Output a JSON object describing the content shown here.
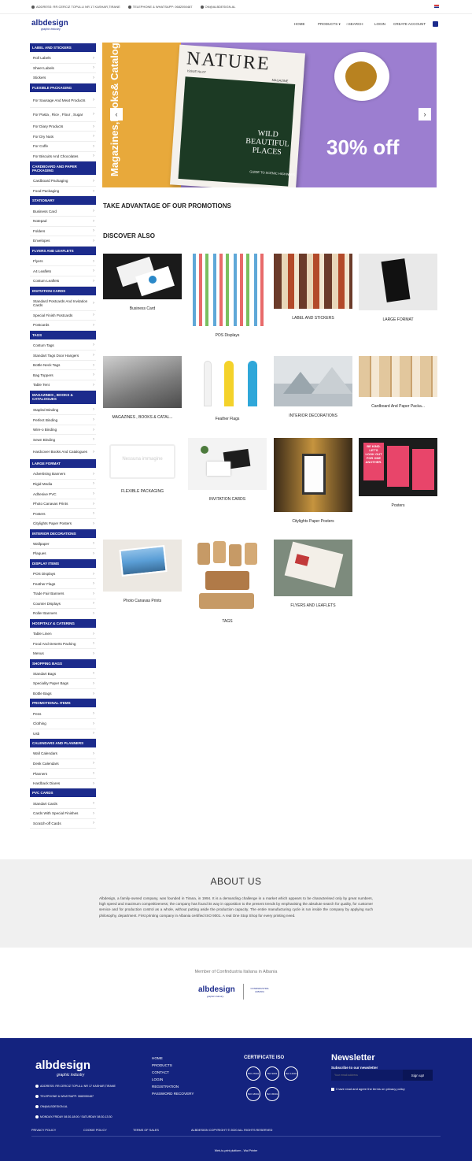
{
  "topbar": {
    "address": "ADDRESS: RR.CERCIZ TOPULLI NR 17 KASHAR,TIRANE",
    "phone": "TELEPHONE & WHATSAPP: 0682050487",
    "email": "ON@ALBDESIGN.AL"
  },
  "header": {
    "logo": "albdesign",
    "logo_sub": "graphic industry",
    "nav": [
      "HOME",
      "PRODUCTS",
      "SEARCH",
      "LOGIN",
      "CREATE ACCOUNT"
    ]
  },
  "sidebar": [
    {
      "title": "LABEL AND STICKERS",
      "items": [
        "Roll Labels",
        "Sheet Labels",
        "Stickers"
      ]
    },
    {
      "title": "FLEXIBLE PACKAGING",
      "items": [
        "For Sausage And Meat Products",
        "For Pasta , Rice , Flour , Sugar",
        "For Diary Products",
        "For Dry Nuts",
        "For Coffe",
        "For Biscuits And Chocolates"
      ]
    },
    {
      "title": "CARDBOARD AND PAPER PACKAGING",
      "items": [
        "Cardboard Packaging",
        "Food Packaging"
      ]
    },
    {
      "title": "STATIONARY",
      "items": [
        "Business Card",
        "Notepad",
        "Folders",
        "Envelopes"
      ]
    },
    {
      "title": "FLYERS AND LEAFLETS",
      "items": [
        "Flyers",
        "A4 Leaflets",
        "Costum Leaflets"
      ]
    },
    {
      "title": "INVITATION CARDS",
      "items": [
        "Standard Postcards And Invitation Cards",
        "Special Finish Postcards",
        "Postcards"
      ]
    },
    {
      "title": "TAGS",
      "items": [
        "Costum Tags",
        "Standart Tags Door Hangers",
        "Bottle Neck Tags",
        "Bag Toppers",
        "Table Tent"
      ]
    },
    {
      "title": "MAGAZINES , BOOKS & CATALOGUES",
      "items": [
        "Stapled Binding",
        "Perfect Binding",
        "Wire-o Binding",
        "Sewn Binding",
        "Hardcover Books And Catalogues"
      ]
    },
    {
      "title": "LARGE FORMAT",
      "items": [
        "Advertising Banners",
        "Rigid Media",
        "Adhesive PVC",
        "Photo Canavas Prints",
        "Posters",
        "Citylights Paper Posters"
      ]
    },
    {
      "title": "INTERIOR DECORATIONS",
      "items": [
        "Wallpaper",
        "Plaques"
      ]
    },
    {
      "title": "DISPLAY ITEMS",
      "items": [
        "POS Displays",
        "Feather Flags",
        "Trade Fair Banners",
        "Counter Displays",
        "Roller Banners"
      ]
    },
    {
      "title": "HOSPITALY & CATERING",
      "items": [
        "Table Linen",
        "Food And Deserts Packing",
        "Menus"
      ]
    },
    {
      "title": "SHOPPING BAGS",
      "items": [
        "Standart Bags",
        "Speciality Paper Bags",
        "Bottle Bags"
      ]
    },
    {
      "title": "PROMOTIONAL ITEMS",
      "items": [
        "Pens",
        "Clothing",
        "Usb"
      ]
    },
    {
      "title": "CALENDARS AND PLANNERS",
      "items": [
        "Wall Calendars",
        "Desk Calendars",
        "Planners",
        "Hardback Diares"
      ]
    },
    {
      "title": "PVC CARDS",
      "items": [
        "Standart Cards",
        "Cards With Special Finishes",
        "Scratch-off Cards"
      ]
    }
  ],
  "slider": {
    "vertical_text": "Magazines,Books& Catalogues",
    "mag_title": "NATURE",
    "mag_issue": "ISSUE No.07",
    "mag_magazine": "MAGAZINE",
    "mag_wild": "WILD BEAUTIFUL PLACES",
    "mag_guide": "GUIDE TO SCENIC HIGHWAYS",
    "promo": "30% off",
    "prev": "‹",
    "next": "›"
  },
  "promotions_title": "TAKE ADVANTAGE OF OUR PROMOTIONS",
  "discover_title": "DISCOVER ALSO",
  "no_image": "Nessuna immagine",
  "cards": [
    "Business Card",
    "POS Displays",
    "LABEL AND STICKERS",
    "LARGE FORMAT",
    "MAGAZINES , BOOKS & CATAL...",
    "Feather Flags",
    "INTERIOR DECORATIONS",
    "Cardboard And Paper Packa...",
    "FLEXIBLE PACKAGING",
    "INVITATION CARDS",
    "Citylights Paper Posters",
    "Posters",
    "Photo Canavas Prints",
    "TAGS",
    "FLYERS AND LEAFLETS"
  ],
  "poster_text": "BE KIND. LET'S LOOK OUT FOR ONE ANOTHER.",
  "about": {
    "title": "ABOUT US",
    "text": "Albdesign, a family-owned company, was founded in Tirana, in 1994. It is a demanding challenge in a market which appears to be characterised only by great numbers, high speed and maximum competitiveness; the company has found its way in opposition to the present trends by emphasising the absolute search for quality, for customer service and for production control as a whole, without putting aside the production capacity. The entire manufacturing cycle is run inside the company by applying such philosophy, department. First printing company in Albania certified ISO 9001. A real One Stop Shop for every printing need."
  },
  "member": {
    "text": "Member of Confindustria Italiana in Albania",
    "conf": "CONFINDUSTRIA ALBANIA"
  },
  "footer": {
    "logo": "albdesign",
    "logo_sub": "graphic industry",
    "address": "ADDRESS: RR.CERCIZ TOPULLI NR 17 KASHAR,TIRANE",
    "phone": "TELEPHONE & WHATSAPP: 0682050487",
    "email": "ON@ALBDESIGN.AL",
    "hours": "MONDAY-FRIDAY 08:30-18:00 / SATURDAY 08:30-13:30",
    "links": [
      "HOME",
      "PRODUCTS",
      "CONTACT",
      "LOGIN",
      "REGISTRATION",
      "PASSWORD RECOVERY"
    ],
    "cert_title": "CERTIFICATE ISO",
    "badges": [
      "ISO 27001",
      "ISO 9001",
      "ISO 14001",
      "ISO 18001",
      "ISO 45001"
    ],
    "nl_title": "Newsletter",
    "nl_sub": "Subscribe to our newsletter",
    "nl_placeholder": "Your email address",
    "nl_button": "Sign up!",
    "nl_check": "I have read and agree the terms on privacy policy",
    "bottom": [
      "PRIVACY POLICY",
      "COOKIE POLICY",
      "TERMS OF SALES",
      "ALBDESIGN COPYRIGHT © 2020 ALL RIGHTS RESERVED"
    ],
    "powered": "Web-to-print platform - Wai Printer"
  },
  "colors": {
    "brand": "#1c2b8c",
    "footer": "#14237f",
    "promo_purple": "#9c7ed0",
    "promo_orange": "#e8a93b"
  }
}
